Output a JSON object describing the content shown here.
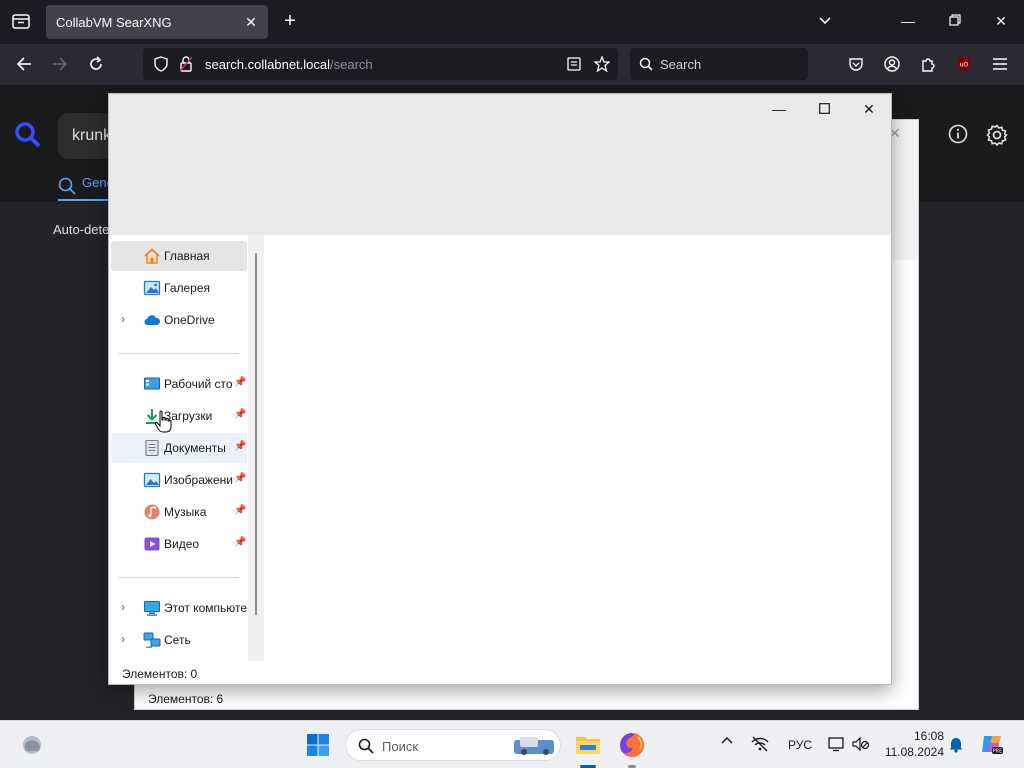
{
  "browser": {
    "tab_title": "CollabVM SearXNG",
    "url_host": "search.collabnet.local",
    "url_path": "/search",
    "search_placeholder": "Search"
  },
  "searxng": {
    "query": "krunk",
    "category_tab": "Gene",
    "autodetect_text": "Auto-dete"
  },
  "explorer_bg": {
    "status": "Элементов: 6"
  },
  "explorer_fg": {
    "status": "Элементов: 0",
    "nav": {
      "home": "Главная",
      "gallery": "Галерея",
      "onedrive": "OneDrive",
      "desktop": "Рабочий сто",
      "downloads": "Загрузки",
      "documents": "Документы",
      "pictures": "Изображени",
      "music": "Музыка",
      "videos": "Видео",
      "this_pc": "Этот компьюте",
      "network": "Сеть"
    }
  },
  "taskbar": {
    "search_label": "Поиск",
    "language": "РУС",
    "time": "16:08",
    "date": "11.08.2024"
  }
}
